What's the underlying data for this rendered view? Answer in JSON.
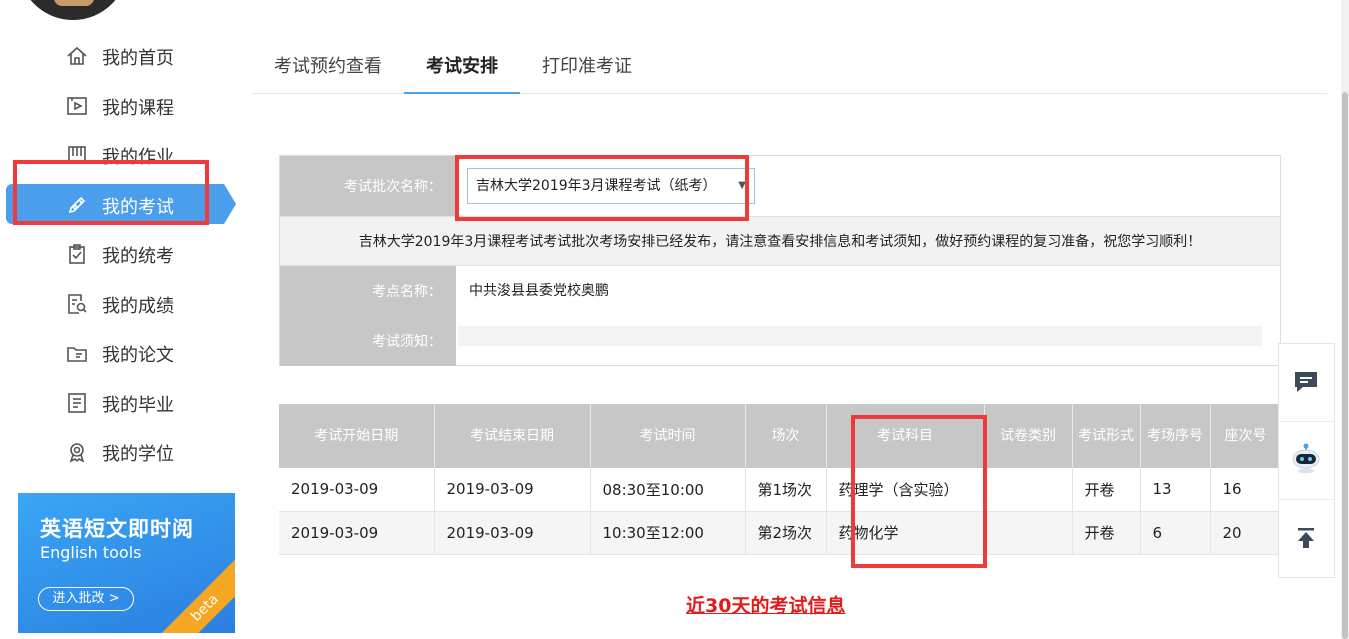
{
  "sidebar": {
    "items": [
      {
        "label": "我的首页",
        "icon": "home-icon"
      },
      {
        "label": "我的课程",
        "icon": "course-play-icon"
      },
      {
        "label": "我的作业",
        "icon": "homework-book-icon"
      },
      {
        "label": "我的考试",
        "icon": "exam-pen-icon",
        "active": true
      },
      {
        "label": "我的统考",
        "icon": "unified-exam-clipboard-icon"
      },
      {
        "label": "我的成绩",
        "icon": "grade-search-icon"
      },
      {
        "label": "我的论文",
        "icon": "thesis-folder-icon"
      },
      {
        "label": "我的毕业",
        "icon": "graduation-list-icon"
      },
      {
        "label": "我的学位",
        "icon": "degree-medal-icon"
      }
    ],
    "active_color": "#4a9eeb"
  },
  "promo": {
    "title": "英语短文即时阅",
    "subtitle": "English tools",
    "button": "进入批改 >",
    "badge": "beta"
  },
  "tabs": [
    {
      "label": "考试预约查看"
    },
    {
      "label": "考试安排",
      "active": true
    },
    {
      "label": "打印准考证"
    }
  ],
  "info": {
    "batch_label": "考试批次名称：",
    "batch_value": "吉林大学2019年3月课程考试（纸考）",
    "notice": "吉林大学2019年3月课程考试考试批次考场安排已经发布，请注意查看安排信息和考试须知，做好预约课程的复习准备，祝您学习顺利！",
    "site_label": "考点名称：",
    "site_value": "中共浚县县委党校奥鹏",
    "rules_label": "考试须知："
  },
  "table": {
    "headers": [
      "考试开始日期",
      "考试结束日期",
      "考试时间",
      "场次",
      "考试科目",
      "试卷类别",
      "考试形式",
      "考场序号",
      "座次号"
    ],
    "rows": [
      [
        "2019-03-09",
        "2019-03-09",
        "08:30至10:00",
        "第1场次",
        "药理学（含实验）",
        "",
        "开卷",
        "13",
        "16"
      ],
      [
        "2019-03-09",
        "2019-03-09",
        "10:30至12:00",
        "第2场次",
        "药物化学",
        "",
        "开卷",
        "6",
        "20"
      ]
    ]
  },
  "recent_link": "近30天的考试信息",
  "floatbar": [
    "chat-bubble-icon",
    "robot-assistant-icon",
    "back-to-top-icon"
  ],
  "colors": {
    "accent": "#4a9eeb",
    "annotation": "#ef3a3a",
    "link_red": "#e51b1b",
    "header_gray": "#c7c7c7"
  }
}
